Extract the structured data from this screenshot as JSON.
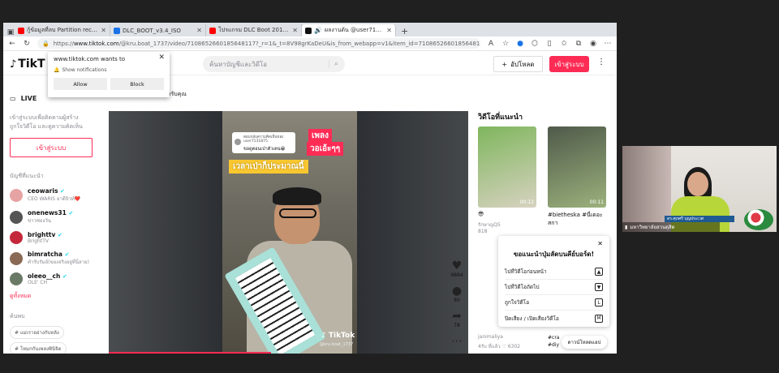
{
  "browser": {
    "tabs": [
      {
        "title": "กู้ข้อมูลที่ลบ Partition recovery ด้วย",
        "color": "#ff0000"
      },
      {
        "title": "DLC_BOOT_v3.4_ISO",
        "color": "#1a73e8"
      },
      {
        "title": "โปรแกรม DLC Boot 2017 แผ่นบูต",
        "color": "#ff0000"
      },
      {
        "title": "ผลงานต้น @user71319875 บน",
        "color": "#111111"
      }
    ],
    "url_prefix": "https://",
    "url_domain": "www.tiktok.com",
    "url_rest": "/@kru.boat_1737/video/7108652660185648117?_r=1&_t=8V98grKaDeU&is_from_webapp=v1&item_id=7108652660185648117",
    "reader_icon": "A⁾",
    "extension_count": ""
  },
  "notification": {
    "title": "www.tiktok.com wants to",
    "message": "Show notifications",
    "allow": "Allow",
    "block": "Block"
  },
  "tiktok": {
    "logo": "TikT",
    "search_placeholder": "ค้นหาบัญชีและวิดีโอ",
    "upload": "อัปโหลด",
    "login": "เข้าสู่ระบบ",
    "for_you_partial": "าหรับคุณ",
    "live": "LIVE",
    "side_text": "เข้าสู่ระบบเพื่อติดตามผู้สร้าง ถูกใจวิดีโอ และดูความคิดเห็น",
    "side_login": "เข้าสู่ระบบ",
    "suggested_title": "บัญชีที่แนะนำ",
    "accounts": [
      {
        "name": "ceowaris",
        "sub": "CEO WARIS ยาดีบิวท์❤️",
        "color": "#e6a3a3"
      },
      {
        "name": "onenews31",
        "sub": "ข่าวช่องวัน",
        "color": "#555555"
      },
      {
        "name": "brighttv",
        "sub": "BrightTV",
        "color": "#c4283a"
      },
      {
        "name": "bimratcha",
        "sub": "คำรับรัมย์(ของจริงอยู่ที่นี่ลาย)",
        "color": "#8a6a55"
      },
      {
        "name": "oleeo__ch",
        "sub": "OLE' CH",
        "color": "#6a7a66"
      }
    ],
    "see_all": "ดูทั้งหมด",
    "discover_title": "ค้นพบ",
    "tags": [
      "แม่เราอย่างกับหลัง",
      "โหมกกันเพลงพินิจิต",
      "thevoiceallstarsth"
    ],
    "video": {
      "comment_head": "ตอบกลับความคิดเห็นของ user7131875",
      "comment_text": "ขอดูตอนเป่าตัวเตน😁",
      "caption1": "เพลง",
      "caption2": "วอเอ้ะๆๆ",
      "caption3": "เวลาเป่าก็ประมาณนี้",
      "watermark": "TikTok",
      "handle": "@kru.boat_1737"
    },
    "actions": [
      {
        "icon": "heart-icon",
        "count": "9884"
      },
      {
        "icon": "comment-icon",
        "count": "80"
      },
      {
        "icon": "share-icon",
        "count": "78"
      },
      {
        "icon": "more-icon",
        "count": ""
      }
    ],
    "recommended_title": "วิดีโอที่แนะนำ",
    "recommended": [
      {
        "duration": "00:12",
        "caption": "😎",
        "user": "รักษาญQ5",
        "views": "818",
        "colors": [
          "#7fb65d",
          "#d7d2c0"
        ]
      },
      {
        "duration": "00:11",
        "caption": "#bietheska #นี่เดอะ สกา",
        "user": "",
        "views": "",
        "colors": [
          "#4f5a4a",
          "#9bb17c"
        ]
      }
    ],
    "bottom_rec": {
      "user": "janimaliya",
      "stats": "4รับ ที่แล้ว",
      "likes": "6302",
      "tags": "#cra #diy"
    },
    "shortcuts": {
      "title": "ขอแนะนำปุ่มลัดบนคีย์บอร์ด!",
      "rows": [
        {
          "label": "ไปที่วิดีโอก่อนหน้า",
          "key": "▲"
        },
        {
          "label": "ไปที่วิดีโอถัดไป",
          "key": "▼"
        },
        {
          "label": "ถูกใจวิดีโอ",
          "key": "L"
        },
        {
          "label": "ปิดเสียง / เปิดเสียงวิดีโอ",
          "key": "M"
        }
      ]
    },
    "download_app": "ดาวน์โหลดแอป"
  },
  "webcam": {
    "label": "มหาวิทยาลัยสวนดุสิต",
    "name_tag": "ดร.ศุภศรี บุญประเวศ"
  }
}
